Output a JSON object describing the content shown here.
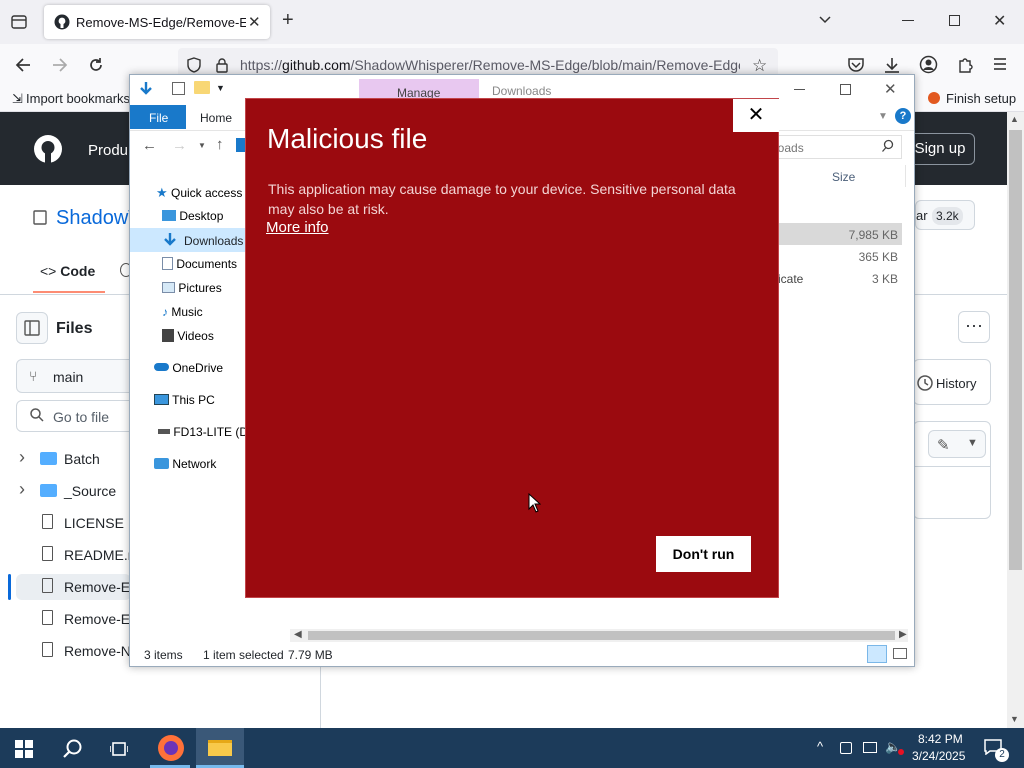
{
  "browser": {
    "tab_title": "Remove-MS-Edge/Remove-Edge",
    "url_prefix": "https://",
    "url_host": "github.com",
    "url_path": "/ShadowWhisperer/Remove-MS-Edge/blob/main/Remove-Edge",
    "bookmarks_import": "Import bookmarks",
    "finish_setup": "Finish setup"
  },
  "github": {
    "header_product": "Produ",
    "sign_up": "Sign up",
    "repo_owner": "ShadowW",
    "code_tab": "Code",
    "files_heading": "Files",
    "branch": "main",
    "go_to_file": "Go to file",
    "star_label": "ar",
    "star_count": "3.2k",
    "history": "History",
    "tree": [
      {
        "label": "Batch",
        "type": "folder"
      },
      {
        "label": "_Source",
        "type": "folder"
      },
      {
        "label": "LICENSE",
        "type": "file"
      },
      {
        "label": "README.m",
        "type": "file"
      },
      {
        "label": "Remove-Ed",
        "type": "file"
      },
      {
        "label": "Remove-Ed",
        "type": "file"
      },
      {
        "label": "Remove-N",
        "type": "file"
      }
    ]
  },
  "explorer": {
    "manage_tab": "Manage",
    "downloads_title": "Downloads",
    "file_tab": "File",
    "home_tab": "Home",
    "search_placeholder": "loads",
    "col_size": "Size",
    "nav": {
      "quick_access": "Quick access",
      "desktop": "Desktop",
      "downloads": "Downloads",
      "documents": "Documents",
      "pictures": "Pictures",
      "music": "Music",
      "videos": "Videos",
      "onedrive": "OneDrive",
      "this_pc": "This PC",
      "drive": "FD13-LITE (D:",
      "network": "Network"
    },
    "rows": [
      {
        "name": "",
        "size": "7,985 KB"
      },
      {
        "name": "",
        "size": "365 KB"
      },
      {
        "name": "ificate",
        "size": "3 KB"
      }
    ],
    "status_items": "3 items",
    "status_selected": "1 item selected",
    "status_size": "7.79 MB"
  },
  "dialog": {
    "title": "Malicious file",
    "message": "This application may cause damage to your device. Sensitive personal data may also be at risk.",
    "more_info": "More info",
    "close_glyph": "✕",
    "dont_run": "Don't run"
  },
  "taskbar": {
    "time": "8:42 PM",
    "date": "3/24/2025",
    "notification_count": "2"
  },
  "colors": {
    "dialog_bg": "#9b0a0f",
    "github_header": "#24292f",
    "taskbar": "#1c3b5a",
    "explorer_accent": "#1979ca"
  }
}
